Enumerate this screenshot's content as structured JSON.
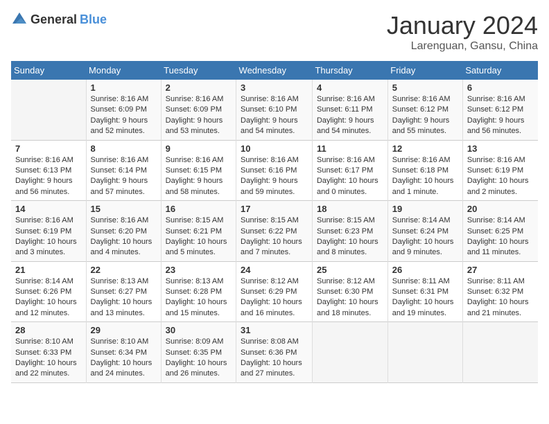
{
  "header": {
    "logo_general": "General",
    "logo_blue": "Blue",
    "month_title": "January 2024",
    "location": "Larenguan, Gansu, China"
  },
  "days_of_week": [
    "Sunday",
    "Monday",
    "Tuesday",
    "Wednesday",
    "Thursday",
    "Friday",
    "Saturday"
  ],
  "weeks": [
    [
      {
        "num": "",
        "sunrise": "",
        "sunset": "",
        "daylight": ""
      },
      {
        "num": "1",
        "sunrise": "Sunrise: 8:16 AM",
        "sunset": "Sunset: 6:09 PM",
        "daylight": "Daylight: 9 hours and 52 minutes."
      },
      {
        "num": "2",
        "sunrise": "Sunrise: 8:16 AM",
        "sunset": "Sunset: 6:09 PM",
        "daylight": "Daylight: 9 hours and 53 minutes."
      },
      {
        "num": "3",
        "sunrise": "Sunrise: 8:16 AM",
        "sunset": "Sunset: 6:10 PM",
        "daylight": "Daylight: 9 hours and 54 minutes."
      },
      {
        "num": "4",
        "sunrise": "Sunrise: 8:16 AM",
        "sunset": "Sunset: 6:11 PM",
        "daylight": "Daylight: 9 hours and 54 minutes."
      },
      {
        "num": "5",
        "sunrise": "Sunrise: 8:16 AM",
        "sunset": "Sunset: 6:12 PM",
        "daylight": "Daylight: 9 hours and 55 minutes."
      },
      {
        "num": "6",
        "sunrise": "Sunrise: 8:16 AM",
        "sunset": "Sunset: 6:12 PM",
        "daylight": "Daylight: 9 hours and 56 minutes."
      }
    ],
    [
      {
        "num": "7",
        "sunrise": "Sunrise: 8:16 AM",
        "sunset": "Sunset: 6:13 PM",
        "daylight": "Daylight: 9 hours and 56 minutes."
      },
      {
        "num": "8",
        "sunrise": "Sunrise: 8:16 AM",
        "sunset": "Sunset: 6:14 PM",
        "daylight": "Daylight: 9 hours and 57 minutes."
      },
      {
        "num": "9",
        "sunrise": "Sunrise: 8:16 AM",
        "sunset": "Sunset: 6:15 PM",
        "daylight": "Daylight: 9 hours and 58 minutes."
      },
      {
        "num": "10",
        "sunrise": "Sunrise: 8:16 AM",
        "sunset": "Sunset: 6:16 PM",
        "daylight": "Daylight: 9 hours and 59 minutes."
      },
      {
        "num": "11",
        "sunrise": "Sunrise: 8:16 AM",
        "sunset": "Sunset: 6:17 PM",
        "daylight": "Daylight: 10 hours and 0 minutes."
      },
      {
        "num": "12",
        "sunrise": "Sunrise: 8:16 AM",
        "sunset": "Sunset: 6:18 PM",
        "daylight": "Daylight: 10 hours and 1 minute."
      },
      {
        "num": "13",
        "sunrise": "Sunrise: 8:16 AM",
        "sunset": "Sunset: 6:19 PM",
        "daylight": "Daylight: 10 hours and 2 minutes."
      }
    ],
    [
      {
        "num": "14",
        "sunrise": "Sunrise: 8:16 AM",
        "sunset": "Sunset: 6:19 PM",
        "daylight": "Daylight: 10 hours and 3 minutes."
      },
      {
        "num": "15",
        "sunrise": "Sunrise: 8:16 AM",
        "sunset": "Sunset: 6:20 PM",
        "daylight": "Daylight: 10 hours and 4 minutes."
      },
      {
        "num": "16",
        "sunrise": "Sunrise: 8:15 AM",
        "sunset": "Sunset: 6:21 PM",
        "daylight": "Daylight: 10 hours and 5 minutes."
      },
      {
        "num": "17",
        "sunrise": "Sunrise: 8:15 AM",
        "sunset": "Sunset: 6:22 PM",
        "daylight": "Daylight: 10 hours and 7 minutes."
      },
      {
        "num": "18",
        "sunrise": "Sunrise: 8:15 AM",
        "sunset": "Sunset: 6:23 PM",
        "daylight": "Daylight: 10 hours and 8 minutes."
      },
      {
        "num": "19",
        "sunrise": "Sunrise: 8:14 AM",
        "sunset": "Sunset: 6:24 PM",
        "daylight": "Daylight: 10 hours and 9 minutes."
      },
      {
        "num": "20",
        "sunrise": "Sunrise: 8:14 AM",
        "sunset": "Sunset: 6:25 PM",
        "daylight": "Daylight: 10 hours and 11 minutes."
      }
    ],
    [
      {
        "num": "21",
        "sunrise": "Sunrise: 8:14 AM",
        "sunset": "Sunset: 6:26 PM",
        "daylight": "Daylight: 10 hours and 12 minutes."
      },
      {
        "num": "22",
        "sunrise": "Sunrise: 8:13 AM",
        "sunset": "Sunset: 6:27 PM",
        "daylight": "Daylight: 10 hours and 13 minutes."
      },
      {
        "num": "23",
        "sunrise": "Sunrise: 8:13 AM",
        "sunset": "Sunset: 6:28 PM",
        "daylight": "Daylight: 10 hours and 15 minutes."
      },
      {
        "num": "24",
        "sunrise": "Sunrise: 8:12 AM",
        "sunset": "Sunset: 6:29 PM",
        "daylight": "Daylight: 10 hours and 16 minutes."
      },
      {
        "num": "25",
        "sunrise": "Sunrise: 8:12 AM",
        "sunset": "Sunset: 6:30 PM",
        "daylight": "Daylight: 10 hours and 18 minutes."
      },
      {
        "num": "26",
        "sunrise": "Sunrise: 8:11 AM",
        "sunset": "Sunset: 6:31 PM",
        "daylight": "Daylight: 10 hours and 19 minutes."
      },
      {
        "num": "27",
        "sunrise": "Sunrise: 8:11 AM",
        "sunset": "Sunset: 6:32 PM",
        "daylight": "Daylight: 10 hours and 21 minutes."
      }
    ],
    [
      {
        "num": "28",
        "sunrise": "Sunrise: 8:10 AM",
        "sunset": "Sunset: 6:33 PM",
        "daylight": "Daylight: 10 hours and 22 minutes."
      },
      {
        "num": "29",
        "sunrise": "Sunrise: 8:10 AM",
        "sunset": "Sunset: 6:34 PM",
        "daylight": "Daylight: 10 hours and 24 minutes."
      },
      {
        "num": "30",
        "sunrise": "Sunrise: 8:09 AM",
        "sunset": "Sunset: 6:35 PM",
        "daylight": "Daylight: 10 hours and 26 minutes."
      },
      {
        "num": "31",
        "sunrise": "Sunrise: 8:08 AM",
        "sunset": "Sunset: 6:36 PM",
        "daylight": "Daylight: 10 hours and 27 minutes."
      },
      {
        "num": "",
        "sunrise": "",
        "sunset": "",
        "daylight": ""
      },
      {
        "num": "",
        "sunrise": "",
        "sunset": "",
        "daylight": ""
      },
      {
        "num": "",
        "sunrise": "",
        "sunset": "",
        "daylight": ""
      }
    ]
  ]
}
